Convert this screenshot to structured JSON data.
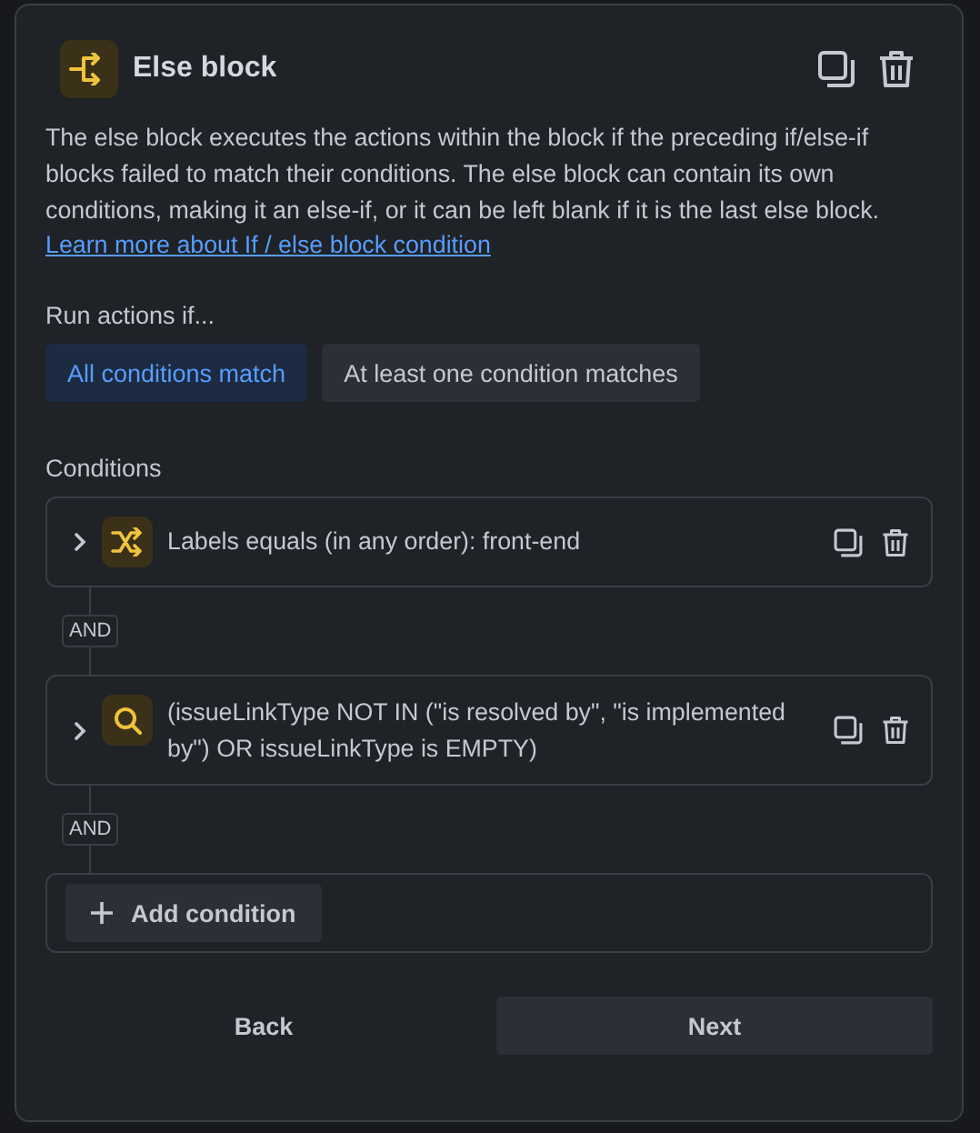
{
  "header": {
    "title": "Else block"
  },
  "description": {
    "text": "The else block executes the actions within the block if the preceding if/else-if blocks failed to match their conditions. The else block can contain its own conditions, making it an else-if, or it can be left blank if it is the last else block.",
    "link": "Learn more about If / else block condition"
  },
  "run_actions": {
    "label": "Run actions if...",
    "options": [
      {
        "label": "All conditions match",
        "selected": true
      },
      {
        "label": "At least one condition matches",
        "selected": false
      }
    ]
  },
  "conditions": {
    "label": "Conditions",
    "items": [
      {
        "kind": "shuffle",
        "text": "Labels equals (in any order): front-end",
        "expanded": false
      },
      {
        "kind": "search",
        "text": "(issueLinkType NOT IN (\"is resolved by\", \"is implemented by\") OR issueLinkType is EMPTY)",
        "expanded": false
      }
    ],
    "connectors": [
      "AND",
      "AND"
    ],
    "add_button": "Add condition"
  },
  "footer": {
    "back": "Back",
    "next": "Next"
  }
}
